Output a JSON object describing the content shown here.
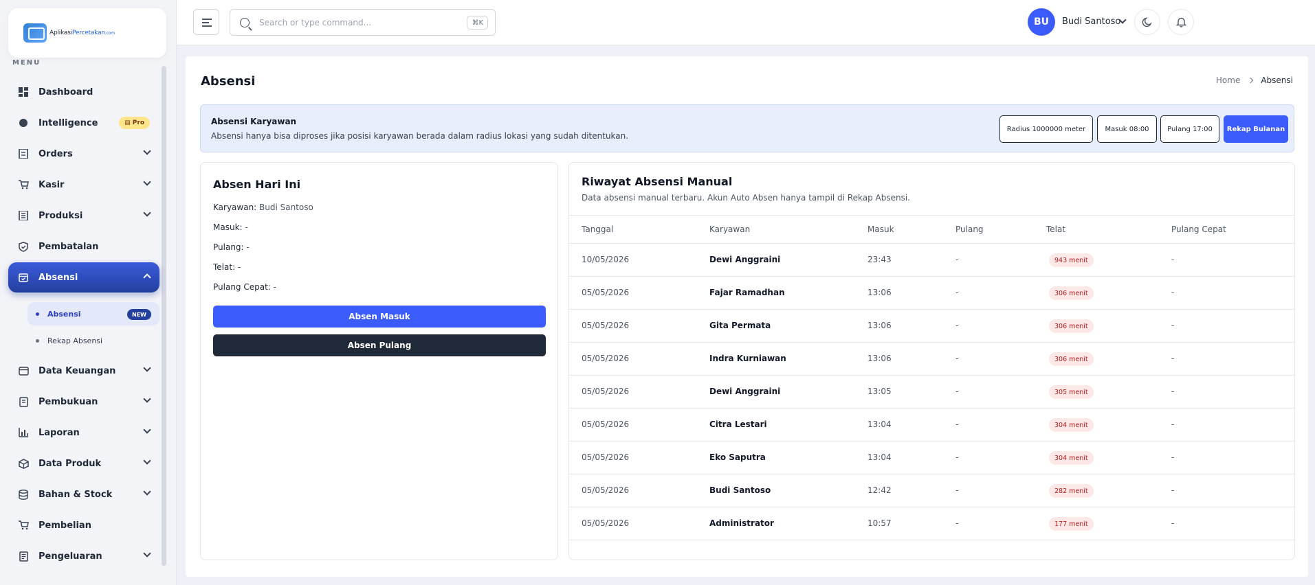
{
  "app": {
    "logo_text": "Aplikasi",
    "logo_text_brand": "Percetakan",
    "logo_suffix": ".com"
  },
  "sidebar": {
    "menu_label": "MENU",
    "items": [
      {
        "label": "Dashboard",
        "icon": "dashboard-icon"
      },
      {
        "label": "Intelligence",
        "icon": "brain-icon",
        "badge": "Pro"
      },
      {
        "label": "Orders",
        "icon": "orders-icon"
      },
      {
        "label": "Kasir",
        "icon": "cart-icon"
      },
      {
        "label": "Produksi",
        "icon": "production-icon"
      },
      {
        "label": "Pembatalan",
        "icon": "shield-icon"
      },
      {
        "label": "Absensi",
        "icon": "calendar-check-icon"
      },
      {
        "label": "Data Keuangan",
        "icon": "wallet-icon"
      },
      {
        "label": "Pembukuan",
        "icon": "book-icon"
      },
      {
        "label": "Laporan",
        "icon": "bar-chart-icon"
      },
      {
        "label": "Data Produk",
        "icon": "box-icon"
      },
      {
        "label": "Bahan & Stock",
        "icon": "database-icon"
      },
      {
        "label": "Pembelian",
        "icon": "cart-icon"
      },
      {
        "label": "Pengeluaran",
        "icon": "receipt-icon"
      }
    ],
    "subitems": [
      {
        "label": "Absensi",
        "badge": "NEW"
      },
      {
        "label": "Rekap Absensi"
      }
    ]
  },
  "topbar": {
    "search_placeholder": "Search or type command...",
    "shortcut": "⌘K",
    "avatar_initials": "BU",
    "user_name": "Budi Santoso"
  },
  "page": {
    "title": "Absensi",
    "breadcrumb": [
      "Home",
      "Absensi"
    ]
  },
  "info": {
    "title": "Absensi Karyawan",
    "description": "Absensi hanya bisa diproses jika posisi karyawan berada dalam radius lokasi yang sudah ditentukan.",
    "chips": [
      "Radius 1000000 meter",
      "Masuk 08:00",
      "Pulang 17:00"
    ],
    "action": "Rekap Bulanan"
  },
  "today": {
    "title": "Absen Hari Ini",
    "rows": [
      {
        "label": "Karyawan:",
        "value": "Budi Santoso"
      },
      {
        "label": "Masuk:",
        "value": "-"
      },
      {
        "label": "Pulang:",
        "value": "-"
      },
      {
        "label": "Telat:",
        "value": "-"
      },
      {
        "label": "Pulang Cepat:",
        "value": "-"
      }
    ],
    "btn_in": "Absen Masuk",
    "btn_out": "Absen Pulang"
  },
  "history": {
    "title": "Riwayat Absensi Manual",
    "subtitle": "Data absensi manual terbaru. Akun Auto Absen hanya tampil di Rekap Absensi.",
    "columns": [
      "Tanggal",
      "Karyawan",
      "Masuk",
      "Pulang",
      "Telat",
      "Pulang Cepat"
    ],
    "rows": [
      {
        "tanggal": "10/05/2026",
        "karyawan": "Dewi Anggraini",
        "masuk": "23:43",
        "pulang": "-",
        "telat": "943 menit",
        "cepat": "-"
      },
      {
        "tanggal": "05/05/2026",
        "karyawan": "Fajar Ramadhan",
        "masuk": "13:06",
        "pulang": "-",
        "telat": "306 menit",
        "cepat": "-"
      },
      {
        "tanggal": "05/05/2026",
        "karyawan": "Gita Permata",
        "masuk": "13:06",
        "pulang": "-",
        "telat": "306 menit",
        "cepat": "-"
      },
      {
        "tanggal": "05/05/2026",
        "karyawan": "Indra Kurniawan",
        "masuk": "13:06",
        "pulang": "-",
        "telat": "306 menit",
        "cepat": "-"
      },
      {
        "tanggal": "05/05/2026",
        "karyawan": "Dewi Anggraini",
        "masuk": "13:05",
        "pulang": "-",
        "telat": "305 menit",
        "cepat": "-"
      },
      {
        "tanggal": "05/05/2026",
        "karyawan": "Citra Lestari",
        "masuk": "13:04",
        "pulang": "-",
        "telat": "304 menit",
        "cepat": "-"
      },
      {
        "tanggal": "05/05/2026",
        "karyawan": "Eko Saputra",
        "masuk": "13:04",
        "pulang": "-",
        "telat": "304 menit",
        "cepat": "-"
      },
      {
        "tanggal": "05/05/2026",
        "karyawan": "Budi Santoso",
        "masuk": "12:42",
        "pulang": "-",
        "telat": "282 menit",
        "cepat": "-"
      },
      {
        "tanggal": "05/05/2026",
        "karyawan": "Administrator",
        "masuk": "10:57",
        "pulang": "-",
        "telat": "177 menit",
        "cepat": "-"
      }
    ]
  },
  "colors": {
    "accent": "#3b5bfb",
    "active_nav": "#23409e",
    "late_bg": "#fde8e8",
    "late_text": "#b91c1c"
  }
}
